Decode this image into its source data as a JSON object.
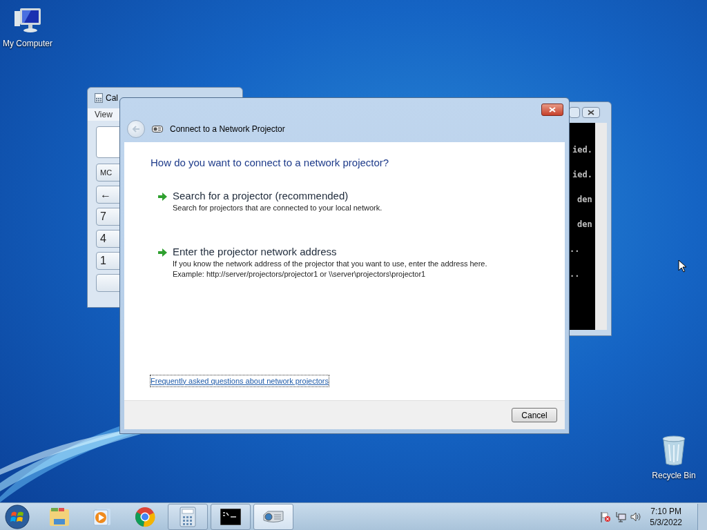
{
  "desktop_icons": [
    {
      "label": "My Computer",
      "kind": "computer"
    },
    {
      "label": "Recycle Bin",
      "kind": "bin"
    }
  ],
  "calculator_window": {
    "title": "Cal",
    "menu": [
      "View"
    ],
    "buttons": [
      "MC",
      "←",
      "7",
      "4",
      "1"
    ]
  },
  "console_window": {
    "lines": [
      "ied.",
      "ied.",
      "den",
      "den",
      "..",
      ".."
    ]
  },
  "dialog": {
    "title": "Connect to a Network Projector",
    "heading": "How do you want to connect to a network projector?",
    "options": [
      {
        "title": "Search for a projector (recommended)",
        "description": [
          "Search for projectors that are connected to your local network."
        ]
      },
      {
        "title": "Enter the projector network address",
        "description": [
          "If you know the network address of the projector that you want to use, enter the address here.",
          "Example: http://server/projectors/projector1 or \\\\server\\projectors\\projector1"
        ]
      }
    ],
    "link": "Frequently asked questions about network projectors",
    "cancel": "Cancel"
  },
  "taskbar": {
    "items": [
      {
        "kind": "explorer",
        "open": false,
        "selected": false
      },
      {
        "kind": "media",
        "open": false,
        "selected": false
      },
      {
        "kind": "chrome",
        "open": false,
        "selected": false
      },
      {
        "kind": "calculator",
        "open": true,
        "selected": false
      },
      {
        "kind": "console",
        "open": true,
        "selected": false
      },
      {
        "kind": "projector",
        "open": true,
        "selected": true
      }
    ],
    "time": "7:10 PM",
    "date": "5/3/2022"
  }
}
